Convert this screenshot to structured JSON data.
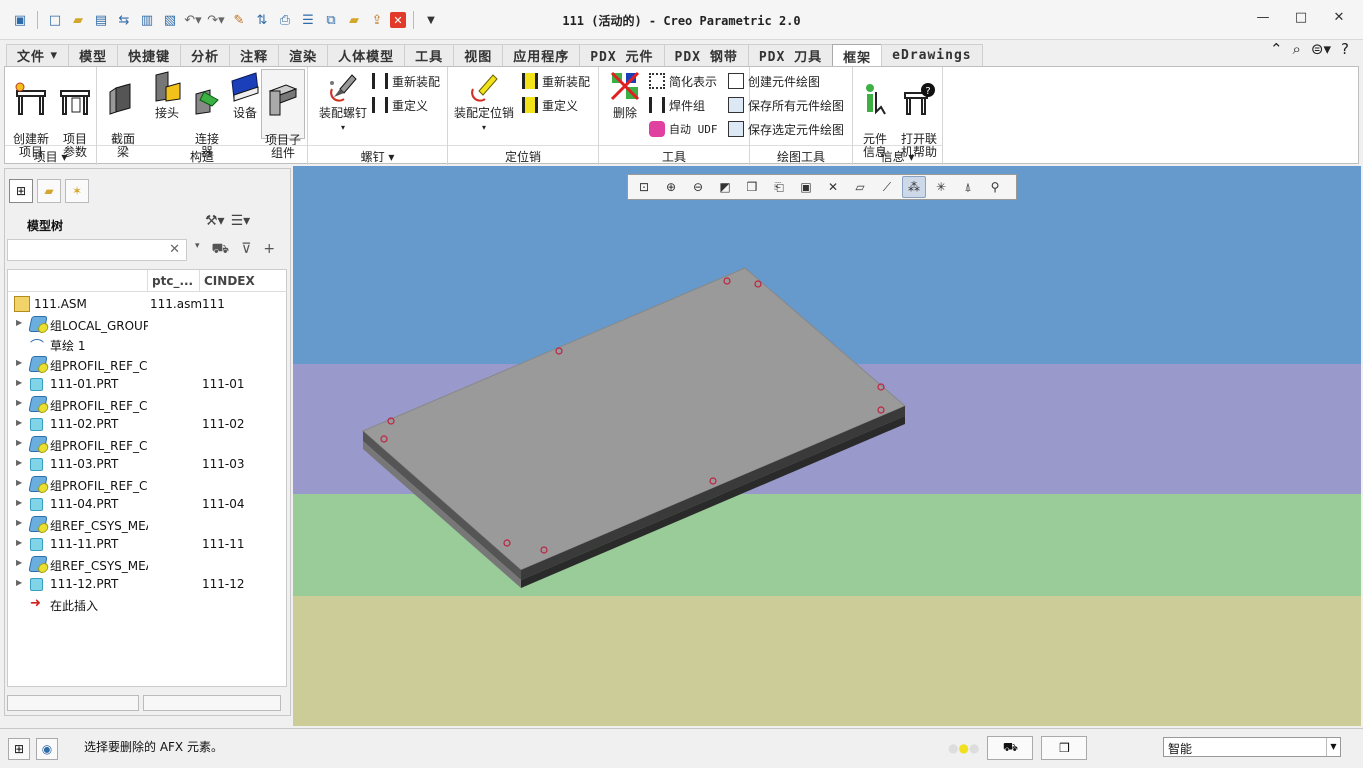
{
  "window": {
    "title": "111 (活动的) - Creo Parametric 2.0",
    "controls": [
      "minimize",
      "maximize",
      "close"
    ]
  },
  "quick_access": [
    "new-icon",
    "open-icon",
    "save-icon",
    "regenerate-icon",
    "window-icon",
    "copy-icon",
    "undo-icon",
    "redo-icon",
    "edit-icon",
    "transfer-icon",
    "print-icon",
    "list-icon",
    "frame-icon",
    "folder-icon",
    "export-icon",
    "close-window-icon"
  ],
  "tabs": [
    {
      "label": "文件",
      "dropdown": true
    },
    {
      "label": "模型"
    },
    {
      "label": "快捷键"
    },
    {
      "label": "分析"
    },
    {
      "label": "注释"
    },
    {
      "label": "渲染"
    },
    {
      "label": "人体模型"
    },
    {
      "label": "工具"
    },
    {
      "label": "视图"
    },
    {
      "label": "应用程序"
    },
    {
      "label": "PDX 元件"
    },
    {
      "label": "PDX 钢带"
    },
    {
      "label": "PDX 刀具"
    },
    {
      "label": "框架",
      "active": true
    },
    {
      "label": "eDrawings"
    }
  ],
  "ribbon": {
    "groups": {
      "project": {
        "label": "项目",
        "buttons": [
          {
            "label": "创建新\n项目"
          },
          {
            "label": "项目\n参数"
          }
        ]
      },
      "construct": {
        "label": "构造",
        "buttons": [
          {
            "label": "截面\n梁"
          },
          {
            "label": "接头"
          },
          {
            "label": "连接\n器"
          },
          {
            "label": "设备"
          },
          {
            "label": "项目子\n组件"
          }
        ]
      },
      "screw": {
        "label": "螺钉",
        "big": "装配螺钉",
        "small": [
          "重新装配",
          "重定义"
        ]
      },
      "pin": {
        "label": "定位销",
        "big": "装配定位销",
        "small": [
          "重新装配",
          "重定义"
        ]
      },
      "tools": {
        "label": "工具",
        "big": "删除",
        "small": [
          "简化表示",
          "焊件组",
          "自动 UDF"
        ]
      },
      "drawing": {
        "label": "绘图工具",
        "small": [
          "创建元件绘图",
          "保存所有元件绘图",
          "保存选定元件绘图"
        ]
      },
      "info": {
        "label": "信息",
        "buttons": [
          {
            "label": "元件\n信息"
          },
          {
            "label": "打开联\n机帮助"
          }
        ]
      }
    }
  },
  "model_tree": {
    "title": "模型树",
    "columns": [
      "ptc_...",
      "CINDEX"
    ],
    "rows": [
      {
        "name": "111.ASM",
        "ptc": "111.asm",
        "cindex": "111",
        "type": "asm",
        "expand": false
      },
      {
        "name": "组LOCAL_GROUP",
        "ptc": "",
        "cindex": "",
        "type": "grp",
        "expand": true
      },
      {
        "name": "草绘 1",
        "ptc": "",
        "cindex": "",
        "type": "sketch",
        "expand": false
      },
      {
        "name": "组PROFIL_REF_CS",
        "ptc": "",
        "cindex": "",
        "type": "grp",
        "expand": true
      },
      {
        "name": "111-01.PRT",
        "ptc": "",
        "cindex": "111-01",
        "type": "prt",
        "expand": true
      },
      {
        "name": "组PROFIL_REF_CS",
        "ptc": "",
        "cindex": "",
        "type": "grp",
        "expand": true
      },
      {
        "name": "111-02.PRT",
        "ptc": "",
        "cindex": "111-02",
        "type": "prt",
        "expand": true
      },
      {
        "name": "组PROFIL_REF_CS",
        "ptc": "",
        "cindex": "",
        "type": "grp",
        "expand": true
      },
      {
        "name": "111-03.PRT",
        "ptc": "",
        "cindex": "111-03",
        "type": "prt",
        "expand": true
      },
      {
        "name": "组PROFIL_REF_CS",
        "ptc": "",
        "cindex": "",
        "type": "grp",
        "expand": true
      },
      {
        "name": "111-04.PRT",
        "ptc": "",
        "cindex": "111-04",
        "type": "prt",
        "expand": true
      },
      {
        "name": "组REF_CSYS_MEA",
        "ptc": "",
        "cindex": "",
        "type": "grp",
        "expand": true
      },
      {
        "name": "111-11.PRT",
        "ptc": "",
        "cindex": "111-11",
        "type": "prt",
        "expand": true
      },
      {
        "name": "组REF_CSYS_MEA",
        "ptc": "",
        "cindex": "",
        "type": "grp",
        "expand": true
      },
      {
        "name": "111-12.PRT",
        "ptc": "",
        "cindex": "111-12",
        "type": "prt",
        "expand": true
      },
      {
        "name": "在此插入",
        "ptc": "",
        "cindex": "",
        "type": "insert",
        "expand": false
      }
    ]
  },
  "view_toolbar": [
    "refit-icon",
    "zoom-in-icon",
    "zoom-out-icon",
    "repaint-icon",
    "display-style-icon",
    "saved-views-icon",
    "view-manager-icon",
    "perspective-icon",
    "datum-plane-icon",
    "datum-axis-icon",
    "datum-point-icon",
    "csys-icon",
    "spin-center-icon",
    "annotation-icon"
  ],
  "status": {
    "message": "选择要删除的 AFX 元素。",
    "filter": "智能"
  },
  "colors": {
    "bg_blue": "#6699cc",
    "bg_purple": "#9999cc",
    "bg_green": "#99cc99",
    "bg_khaki": "#cccc99",
    "plate_top": "#9a9a9a",
    "plate_edge": "#3a3a3a"
  }
}
